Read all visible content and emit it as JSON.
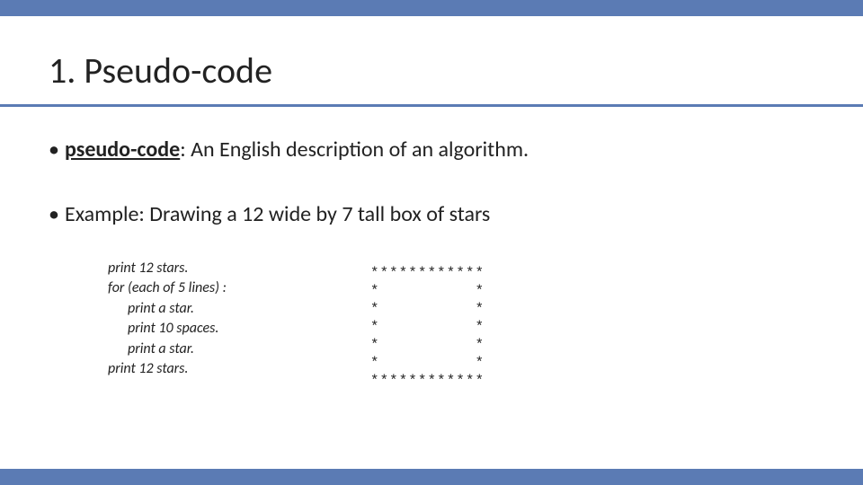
{
  "title": "1. Pseudo-code",
  "bullet1_term": "pseudo-code",
  "bullet1_rest": ": An English description of an algorithm.",
  "bullet2": "Example: Drawing a 12 wide by 7 tall box of stars",
  "pseudo": {
    "l1": "print 12 stars.",
    "l2": "for (each of 5 lines) :",
    "l3": "print a star.",
    "l4": "print 10 spaces.",
    "l5": "print a star.",
    "l6": "print 12 stars."
  },
  "output": "************\n*          *\n*          *\n*          *\n*          *\n*          *\n************",
  "chart_data": {
    "type": "table",
    "description": "7x12 box of stars (border of asterisks, hollow interior)",
    "rows": 7,
    "cols": 12
  }
}
